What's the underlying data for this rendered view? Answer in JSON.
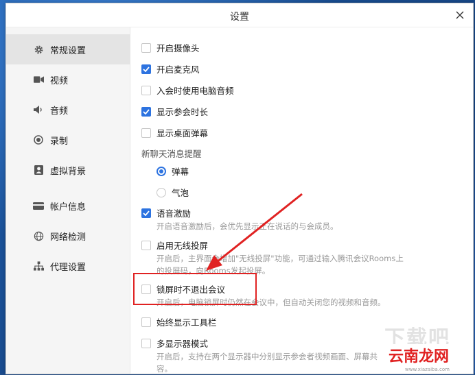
{
  "window": {
    "title": "设置"
  },
  "sidebar": {
    "items": [
      {
        "label": "常规设置",
        "icon": "gear-icon",
        "active": true
      },
      {
        "label": "视频",
        "icon": "video-camera-icon"
      },
      {
        "label": "音频",
        "icon": "speaker-icon"
      },
      {
        "label": "录制",
        "icon": "record-icon"
      },
      {
        "label": "虚拟背景",
        "icon": "person-icon"
      },
      {
        "label": "帐户信息",
        "icon": "card-icon"
      },
      {
        "label": "网络检测",
        "icon": "globe-icon"
      },
      {
        "label": "代理设置",
        "icon": "network-icon"
      }
    ]
  },
  "settings": {
    "camera": {
      "label": "开启摄像头",
      "checked": false
    },
    "mic": {
      "label": "开启麦克风",
      "checked": true
    },
    "pc_audio": {
      "label": "入会时使用电脑音频",
      "checked": false
    },
    "duration": {
      "label": "显示参会时长",
      "checked": true
    },
    "desktop_popup": {
      "label": "显示桌面弹幕",
      "checked": false
    },
    "chat_section": "新聊天消息提醒",
    "radio_danmu": {
      "label": "弹幕",
      "selected": true
    },
    "radio_bubble": {
      "label": "气泡",
      "selected": false
    },
    "voice": {
      "label": "语音激励",
      "checked": true,
      "desc": "开启语音激励后，会优先显示正在说话的与会成员。"
    },
    "wireless": {
      "label": "启用无线投屏",
      "checked": false,
      "desc1": "开启后，主界面会增加\"无线投屏\"功能，可通过输入腾讯会议Rooms上",
      "desc2": "的投屏码，向Rooms发起投屏。"
    },
    "lock_screen": {
      "label": "锁屏时不退出会议",
      "checked": false,
      "desc": "开启后，电脑锁屏时仍然在会议中，但自动关闭您的视频和音频。"
    },
    "toolbar": {
      "label": "始终显示工具栏",
      "checked": false
    },
    "multi_display": {
      "label": "多显示器模式",
      "checked": false,
      "desc1": "开启后，支持在两个显示器中分别显示参会者视频画面、屏幕共",
      "desc2": "容。"
    }
  },
  "watermark": {
    "faded": "下载吧",
    "brand": "云南龙网",
    "url": "www.xiazaiba.com"
  },
  "colors": {
    "accent": "#2d73e0",
    "annotation": "#e02222"
  }
}
